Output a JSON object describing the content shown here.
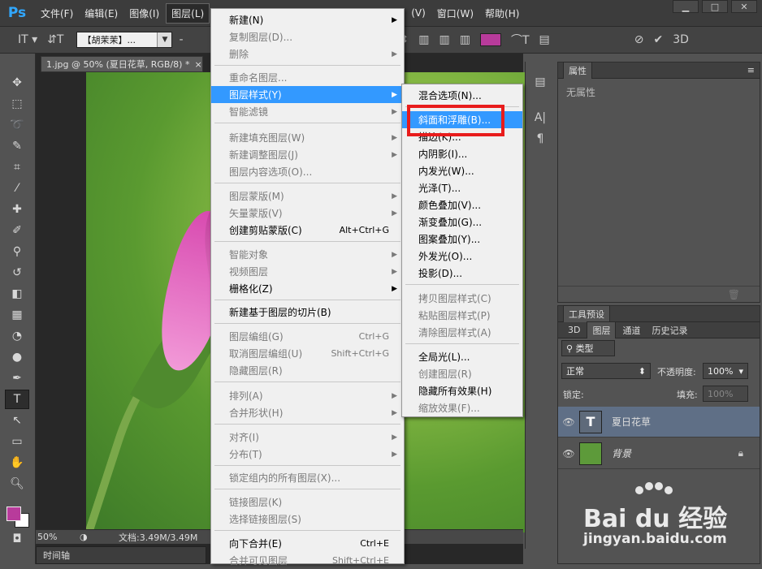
{
  "app": {
    "logo": "Ps"
  },
  "menubar": {
    "items": [
      "文件(F)",
      "编辑(E)",
      "图像(I)",
      "图层(L)",
      "视图(V)",
      "窗口(W)",
      "帮助(H)"
    ],
    "hidden_partial": "(V)",
    "window_controls": [
      "▁",
      "□",
      "✕"
    ]
  },
  "options_bar": {
    "font_family": "【胡茉茉】...",
    "swatch_color": "#b83b9b"
  },
  "document": {
    "tab_title": "1.jpg @ 50% (夏日花草, RGB/8) *",
    "tab_close": "×",
    "zoom": "50%",
    "doc_info": "文档:3.49M/3.49M",
    "timeline_label": "时间轴"
  },
  "layer_menu": {
    "items": [
      {
        "label": "新建(N)",
        "disabled": false,
        "submenu": true
      },
      {
        "label": "复制图层(D)...",
        "disabled": true
      },
      {
        "label": "删除",
        "disabled": true,
        "submenu": true
      },
      {
        "label": "重命名图层...",
        "disabled": true
      },
      {
        "label": "图层样式(Y)",
        "disabled": false,
        "submenu": true,
        "highlighted": true
      },
      {
        "label": "智能滤镜",
        "disabled": true,
        "submenu": true
      },
      {
        "label": "新建填充图层(W)",
        "disabled": true,
        "submenu": true
      },
      {
        "label": "新建调整图层(J)",
        "disabled": true,
        "submenu": true
      },
      {
        "label": "图层内容选项(O)...",
        "disabled": true
      },
      {
        "label": "图层蒙版(M)",
        "disabled": true,
        "submenu": true
      },
      {
        "label": "矢量蒙版(V)",
        "disabled": true,
        "submenu": true
      },
      {
        "label": "创建剪贴蒙版(C)",
        "disabled": false,
        "shortcut": "Alt+Ctrl+G"
      },
      {
        "label": "智能对象",
        "disabled": true,
        "submenu": true
      },
      {
        "label": "视频图层",
        "disabled": true,
        "submenu": true
      },
      {
        "label": "栅格化(Z)",
        "disabled": false,
        "submenu": true
      },
      {
        "label": "新建基于图层的切片(B)",
        "disabled": false
      },
      {
        "label": "图层编组(G)",
        "disabled": true,
        "shortcut": "Ctrl+G"
      },
      {
        "label": "取消图层编组(U)",
        "disabled": true,
        "shortcut": "Shift+Ctrl+G"
      },
      {
        "label": "隐藏图层(R)",
        "disabled": true
      },
      {
        "label": "排列(A)",
        "disabled": true,
        "submenu": true
      },
      {
        "label": "合并形状(H)",
        "disabled": true,
        "submenu": true
      },
      {
        "label": "对齐(I)",
        "disabled": true,
        "submenu": true
      },
      {
        "label": "分布(T)",
        "disabled": true,
        "submenu": true
      },
      {
        "label": "锁定组内的所有图层(X)...",
        "disabled": true
      },
      {
        "label": "链接图层(K)",
        "disabled": true
      },
      {
        "label": "选择链接图层(S)",
        "disabled": true
      },
      {
        "label": "向下合并(E)",
        "disabled": false,
        "shortcut": "Ctrl+E"
      },
      {
        "label": "合并可见图层",
        "disabled": true,
        "shortcut": "Shift+Ctrl+E"
      }
    ]
  },
  "style_submenu": {
    "items": [
      {
        "label": "混合选项(N)...",
        "disabled": false
      },
      {
        "label": "斜面和浮雕(B)...",
        "disabled": false,
        "highlighted": true
      },
      {
        "label": "描边(K)...",
        "disabled": false
      },
      {
        "label": "内阴影(I)...",
        "disabled": false
      },
      {
        "label": "内发光(W)...",
        "disabled": false
      },
      {
        "label": "光泽(T)...",
        "disabled": false
      },
      {
        "label": "颜色叠加(V)...",
        "disabled": false
      },
      {
        "label": "渐变叠加(G)...",
        "disabled": false
      },
      {
        "label": "图案叠加(Y)...",
        "disabled": false
      },
      {
        "label": "外发光(O)...",
        "disabled": false
      },
      {
        "label": "投影(D)...",
        "disabled": false
      },
      {
        "label": "拷贝图层样式(C)",
        "disabled": true
      },
      {
        "label": "粘贴图层样式(P)",
        "disabled": true
      },
      {
        "label": "清除图层样式(A)",
        "disabled": true
      },
      {
        "label": "全局光(L)...",
        "disabled": false
      },
      {
        "label": "创建图层(R)",
        "disabled": true
      },
      {
        "label": "隐藏所有效果(H)",
        "disabled": false
      },
      {
        "label": "缩放效果(F)...",
        "disabled": true
      }
    ]
  },
  "properties_panel": {
    "title": "属性",
    "empty_text": "无属性"
  },
  "tool_presets_panel": {
    "title": "工具预设"
  },
  "layers_panel": {
    "tabs": [
      "3D",
      "图层",
      "通道",
      "历史记录"
    ],
    "active_tab": "图层",
    "filter_label": "类型",
    "blend_mode": "正常",
    "opacity_label": "不透明度:",
    "opacity_value": "100%",
    "lock_label": "锁定:",
    "fill_label": "填充:",
    "fill_value": "100%",
    "layers": [
      {
        "name": "夏日花草",
        "type": "text",
        "selected": true
      },
      {
        "name": "背景",
        "type": "image",
        "locked": true
      }
    ]
  },
  "watermark": {
    "brand": "Bai du 经验",
    "url": "jingyan.baidu.com"
  },
  "colors": {
    "menu_highlight": "#3399ff",
    "callout_box": "#e81c1c",
    "foreground_swatch": "#b83b9b"
  }
}
